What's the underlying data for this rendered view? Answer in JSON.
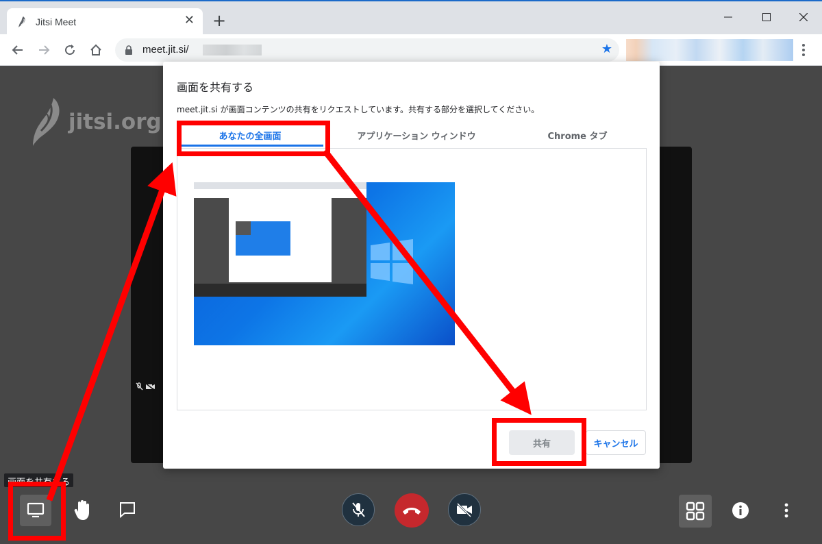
{
  "browser": {
    "tab_title": "Jitsi Meet",
    "new_tab": "+",
    "url": "meet.jit.si/",
    "colors": {
      "accent": "#1a73e8",
      "tabbar": "#dee1e6"
    }
  },
  "meeting": {
    "logo_text": "jitsi.org",
    "tooltip": "画面を共有する",
    "colors": {
      "stage": "#474747",
      "hangup": "#c5282d"
    },
    "toolbar_icons": [
      "desktop-icon",
      "raise-hand-icon",
      "chat-icon",
      "mic-off-icon",
      "hangup-icon",
      "camera-off-icon",
      "tile-view-icon",
      "info-icon",
      "more-icon"
    ]
  },
  "dialog": {
    "title": "画面を共有する",
    "description": "meet.jit.si が画面コンテンツの共有をリクエストしています。共有する部分を選択してください。",
    "tabs": [
      {
        "label": "あなたの全画面",
        "selected": true
      },
      {
        "label": "アプリケーション ウィンドウ",
        "selected": false
      },
      {
        "label": "Chrome タブ",
        "selected": false
      }
    ],
    "share_button": "共有",
    "cancel_button": "キャンセル"
  },
  "annotations": {
    "color": "#ff0000"
  }
}
